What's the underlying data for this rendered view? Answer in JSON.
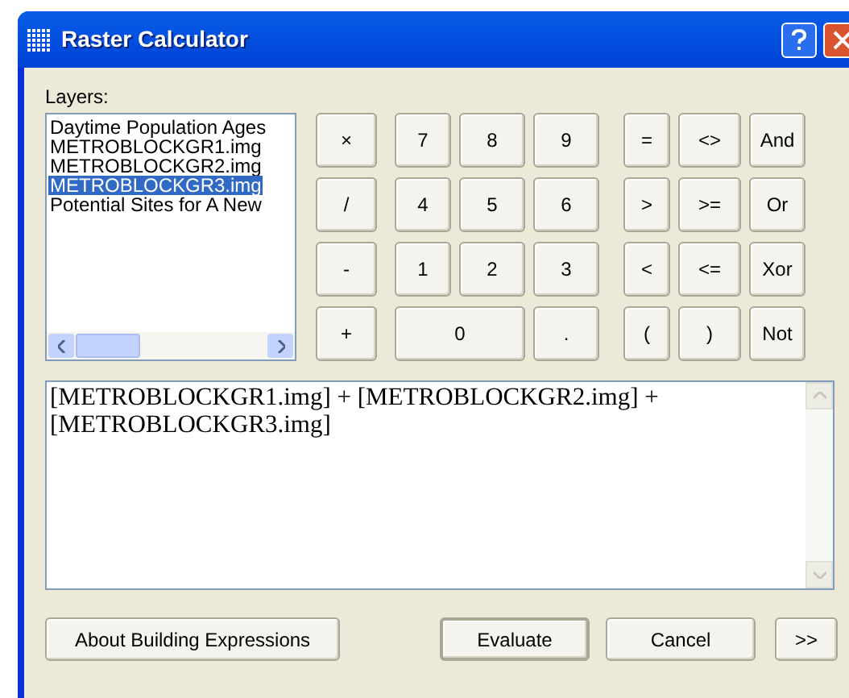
{
  "window": {
    "title": "Raster Calculator"
  },
  "layers": {
    "label": "Layers:",
    "items": [
      {
        "label": "Daytime Population Ages",
        "selected": false
      },
      {
        "label": "METROBLOCKGR1.img",
        "selected": false
      },
      {
        "label": "METROBLOCKGR2.img",
        "selected": false
      },
      {
        "label": "METROBLOCKGR3.img",
        "selected": true
      },
      {
        "label": "Potential Sites for A New",
        "selected": false
      }
    ]
  },
  "keypad": [
    [
      {
        "label": "×",
        "kind": "key"
      },
      {
        "label": "7",
        "kind": "key"
      },
      {
        "label": "8",
        "kind": "key"
      },
      {
        "label": "9",
        "kind": "key"
      },
      {
        "label": "=",
        "kind": "key"
      },
      {
        "label": "<>",
        "kind": "key"
      },
      {
        "label": "And",
        "kind": "key"
      }
    ],
    [
      {
        "label": "/",
        "kind": "key"
      },
      {
        "label": "4",
        "kind": "key"
      },
      {
        "label": "5",
        "kind": "key"
      },
      {
        "label": "6",
        "kind": "key"
      },
      {
        "label": ">",
        "kind": "key"
      },
      {
        "label": ">=",
        "kind": "key"
      },
      {
        "label": "Or",
        "kind": "key"
      }
    ],
    [
      {
        "label": "-",
        "kind": "key"
      },
      {
        "label": "1",
        "kind": "key"
      },
      {
        "label": "2",
        "kind": "key"
      },
      {
        "label": "3",
        "kind": "key"
      },
      {
        "label": "<",
        "kind": "key"
      },
      {
        "label": "<=",
        "kind": "key"
      },
      {
        "label": "Xor",
        "kind": "key"
      }
    ],
    [
      {
        "label": "+",
        "kind": "key"
      },
      {
        "label": "0",
        "kind": "wide"
      },
      {
        "label": ".",
        "kind": "key"
      },
      {
        "label": "(",
        "kind": "key"
      },
      {
        "label": ")",
        "kind": "key"
      },
      {
        "label": "Not",
        "kind": "key"
      }
    ]
  ],
  "expression": {
    "value": "[METROBLOCKGR1.img] + [METROBLOCKGR2.img] + [METROBLOCKGR3.img]"
  },
  "buttons": [
    {
      "label": "About Building Expressions",
      "kind": "about"
    },
    {
      "label": "Evaluate",
      "kind": "default"
    },
    {
      "label": "Cancel",
      "kind": "normal"
    },
    {
      "label": ">>",
      "kind": "more"
    }
  ]
}
